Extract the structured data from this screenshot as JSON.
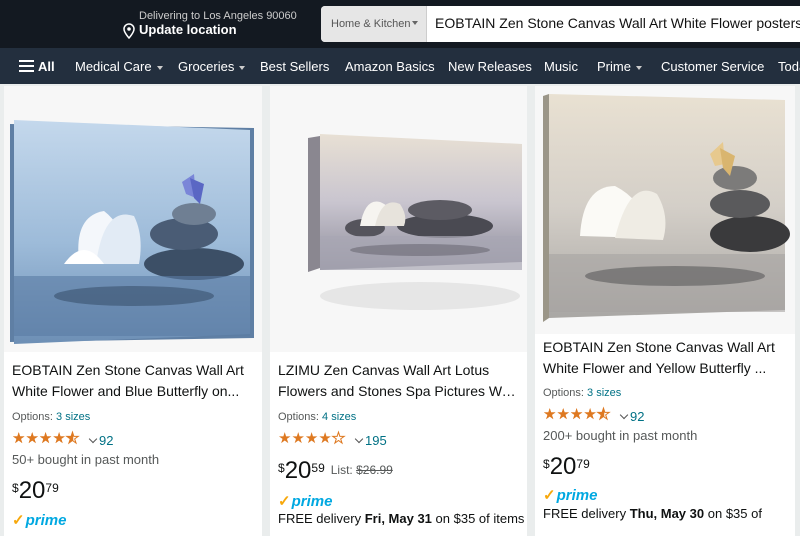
{
  "header": {
    "deliver_line1": "Delivering to Los Angeles 90060",
    "deliver_line2": "Update location",
    "search_category": "Home & Kitchen",
    "search_query": "EOBTAIN Zen Stone Canvas Wall Art White Flower posters"
  },
  "nav": {
    "all": "All",
    "items": [
      "Medical Care",
      "Groceries",
      "Best Sellers",
      "Amazon Basics",
      "New Releases",
      "Music",
      "Prime",
      "Customer Service",
      "Toda"
    ]
  },
  "products": [
    {
      "title_l1": "EOBTAIN Zen Stone Canvas Wall Art",
      "title_l2": "White Flower and Blue Butterfly on...",
      "options_label": "Options:",
      "options_link": "3 sizes",
      "rating": 4.5,
      "rating_count": "92",
      "bought": "50+ bought in past month",
      "price_symbol": "$",
      "price_whole": "20",
      "price_fraction": "79",
      "prime_label": "prime"
    },
    {
      "title_l1": "LZIMU Zen Canvas Wall Art Lotus",
      "title_l2": "Flowers and Stones Spa Pictures Wa...",
      "options_label": "Options:",
      "options_link": "4 sizes",
      "rating": 4.0,
      "rating_count": "195",
      "price_symbol": "$",
      "price_whole": "20",
      "price_fraction": "59",
      "list_label": "List:",
      "list_price": "$26.99",
      "prime_label": "prime",
      "delivery_prefix": "FREE delivery",
      "delivery_date": "Fri, May 31",
      "delivery_suffix": "on $35 of items"
    },
    {
      "title_l1": "EOBTAIN Zen Stone Canvas Wall Art",
      "title_l2": "White Flower and Yellow Butterfly ...",
      "options_label": "Options:",
      "options_link": "3 sizes",
      "rating": 4.5,
      "rating_count": "92",
      "bought": "200+ bought in past month",
      "price_symbol": "$",
      "price_whole": "20",
      "price_fraction": "79",
      "prime_label": "prime",
      "delivery_prefix": "FREE delivery",
      "delivery_date": "Thu, May 30",
      "delivery_suffix": "on $35 of"
    }
  ],
  "colors": {
    "header_bg": "#131921",
    "nav_bg": "#232f3e",
    "star": "#de7921",
    "link": "#007185",
    "prime": "#00a8e1"
  }
}
